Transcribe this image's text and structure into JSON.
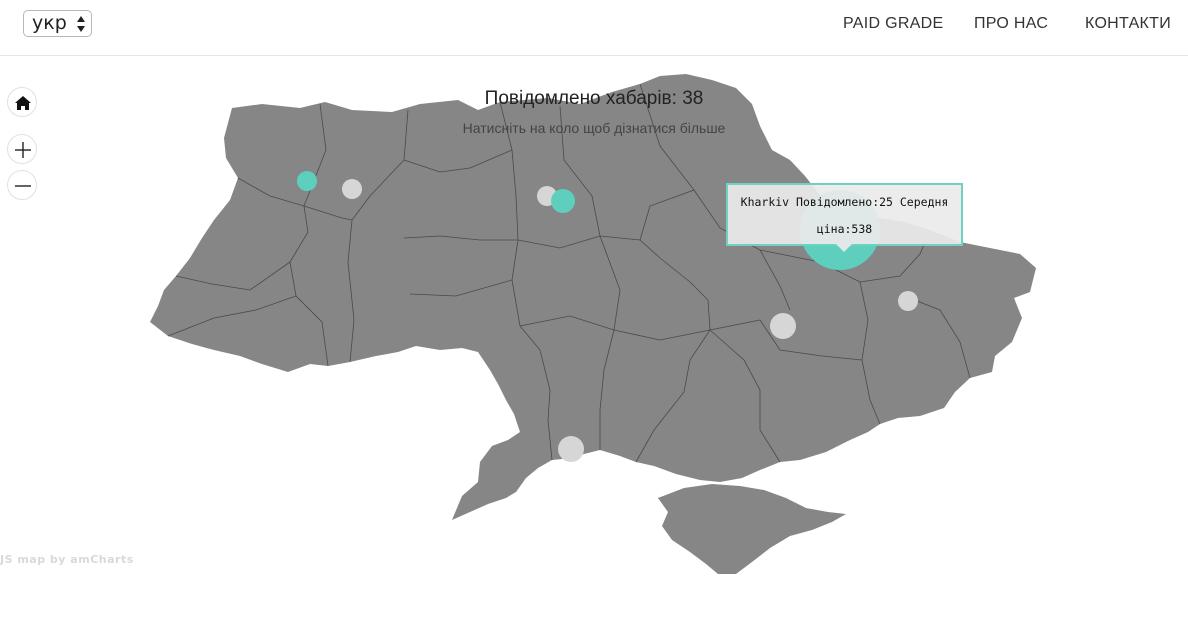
{
  "header": {
    "language": {
      "selected": "укр"
    },
    "nav": [
      {
        "label": "PAID GRADE"
      },
      {
        "label": "ПРО НАС"
      },
      {
        "label": "КОНТАКТИ"
      }
    ]
  },
  "map_controls": {
    "home_icon": "home-icon",
    "zoom_in_icon": "plus-icon",
    "zoom_out_icon": "minus-icon"
  },
  "map": {
    "title": "Повідомлено хабарів: 38",
    "subtitle": "Натисніть на коло щоб дізнатися більше",
    "region_fill": "#868686",
    "highlight_color": "#5ecfbd",
    "marker_color": "#d6d6d6",
    "tooltip": {
      "line1": "Kharkiv Повідомлено:25 Середня",
      "line2": "ціна:538"
    },
    "credit": "JS map by amCharts"
  }
}
